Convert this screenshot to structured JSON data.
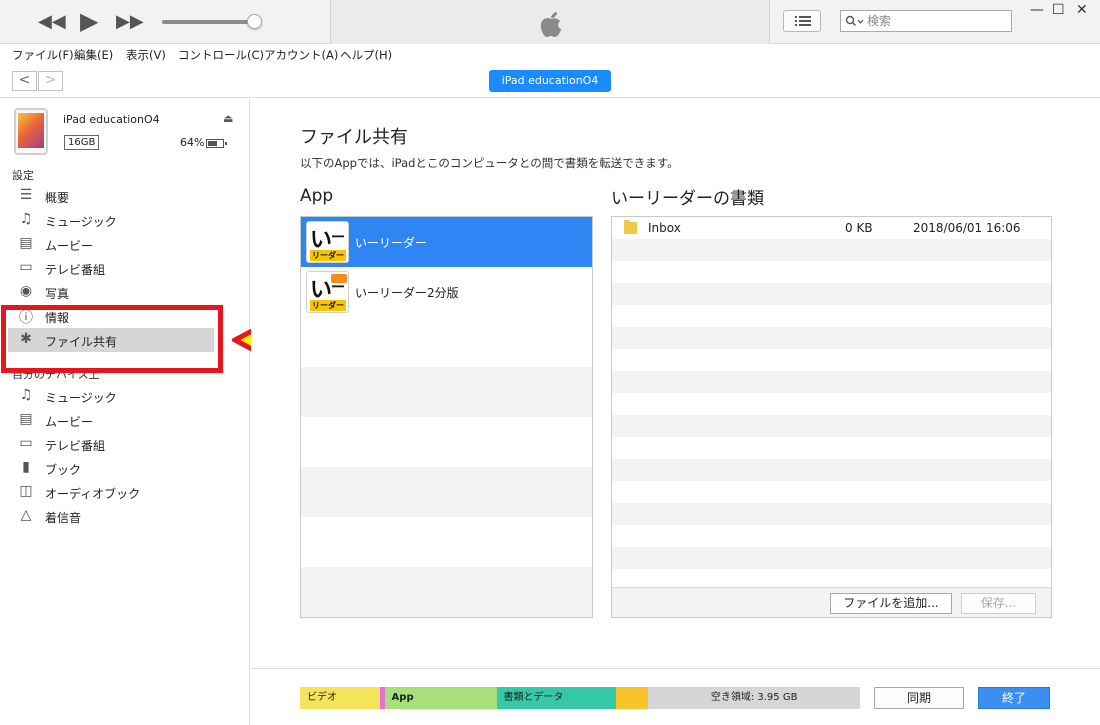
{
  "topbar": {
    "search_placeholder": "検索",
    "volume_level": 0.97,
    "icons": [
      "rewind-icon",
      "play-icon",
      "fast-forward-icon",
      "apple-logo-icon",
      "list-view-icon",
      "search-icon",
      "minimize-icon",
      "maximize-icon",
      "close-icon"
    ]
  },
  "menu": {
    "items": [
      "ファイル(F)",
      "編集(E)",
      "表示(V)",
      "コントロール(C)",
      "アカウント(A)",
      "ヘルプ(H)"
    ]
  },
  "nav": {
    "back": "<",
    "forward": ">",
    "device_pill": "iPad educationO4"
  },
  "device": {
    "name": "iPad educationO4",
    "capacity": "16GB",
    "battery": "64%",
    "battery_level": 0.64
  },
  "sidebar": {
    "settings_header": "設定",
    "settings_items": [
      {
        "label": "概要",
        "icon": "summary-icon"
      },
      {
        "label": "ミュージック",
        "icon": "music-note-icon"
      },
      {
        "label": "ムービー",
        "icon": "film-icon"
      },
      {
        "label": "テレビ番組",
        "icon": "tv-icon"
      },
      {
        "label": "写真",
        "icon": "camera-icon"
      },
      {
        "label": "情報",
        "icon": "info-icon"
      },
      {
        "label": "ファイル共有",
        "icon": "app-store-icon",
        "selected": true
      }
    ],
    "mydevice_header": "自分のデバイス上",
    "mydevice_items": [
      {
        "label": "ミュージック",
        "icon": "music-note-icon"
      },
      {
        "label": "ムービー",
        "icon": "film-icon"
      },
      {
        "label": "テレビ番組",
        "icon": "tv-icon"
      },
      {
        "label": "ブック",
        "icon": "book-icon"
      },
      {
        "label": "オーディオブック",
        "icon": "audiobook-icon"
      },
      {
        "label": "着信音",
        "icon": "bell-icon"
      }
    ]
  },
  "annotation": {
    "highlight_color": "#e8141e",
    "arrow_color": "#fff200"
  },
  "file_sharing": {
    "title": "ファイル共有",
    "description": "以下のAppでは、iPadとこのコンピュータとの間で書類を転送できます。",
    "apps_header": "App",
    "apps": [
      {
        "name": "いーリーダー",
        "selected": true
      },
      {
        "name": "いーリーダー2分版",
        "selected": false
      }
    ],
    "docs_header": "いーリーダーの書類",
    "documents": [
      {
        "name": "Inbox",
        "size": "0 KB",
        "date": "2018/06/01 16:06"
      }
    ],
    "add_file_button": "ファイルを追加...",
    "save_button": "保存..."
  },
  "storage": {
    "segments": [
      {
        "label": "ビデオ",
        "color": "#f5e35a",
        "fraction": 0.142
      },
      {
        "label": "",
        "color": "#e46fd6",
        "fraction": 0.009
      },
      {
        "label": "App",
        "color": "#a6e07a",
        "fraction": 0.2
      },
      {
        "label": "書類とデータ",
        "color": "#35c9a8",
        "fraction": 0.214
      },
      {
        "label": "",
        "color": "#f8c42a",
        "fraction": 0.057
      },
      {
        "label": "空き領域: 3.95 GB",
        "color": "#d6d6d6",
        "fraction": 0.378
      }
    ],
    "sync_button": "同期",
    "done_button": "終了"
  }
}
